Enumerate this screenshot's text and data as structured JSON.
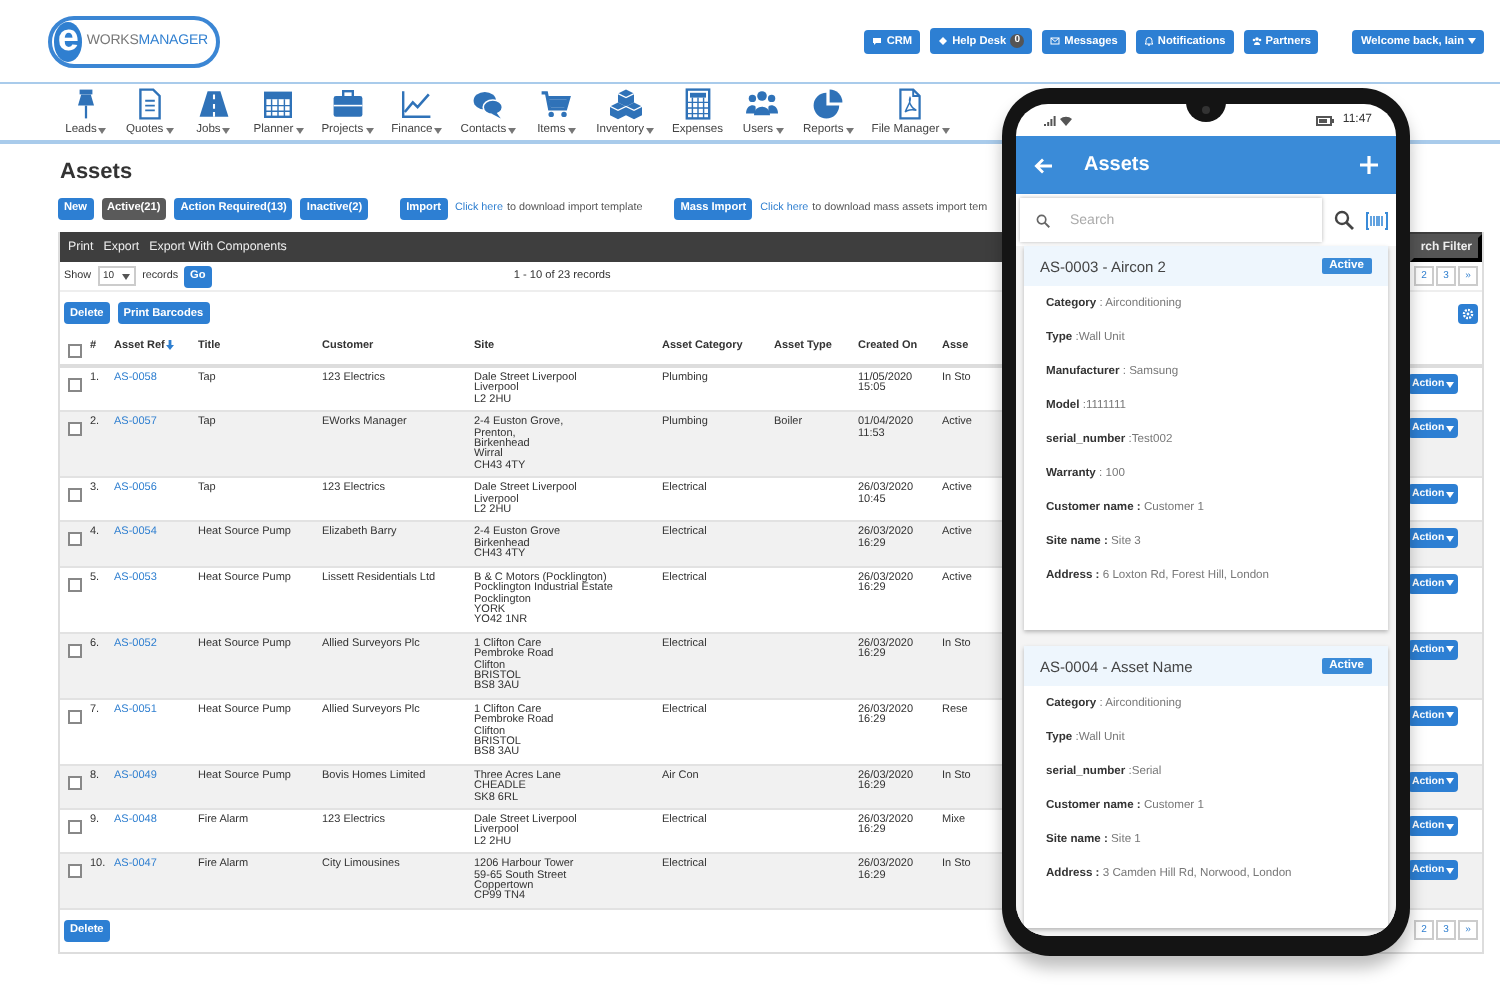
{
  "header": {
    "logo": {
      "mark": "e",
      "prefix": "WORKS",
      "name": "MANAGER"
    },
    "buttons": [
      {
        "label": "CRM"
      },
      {
        "label": "Help Desk",
        "badge": "0"
      },
      {
        "label": "Messages"
      },
      {
        "label": "Notifications"
      },
      {
        "label": "Partners"
      }
    ],
    "user_menu": "Welcome back, Iain"
  },
  "nav": [
    {
      "label": "Leads",
      "dropdown": true
    },
    {
      "label": "Quotes",
      "dropdown": true
    },
    {
      "label": "Jobs",
      "dropdown": true
    },
    {
      "label": "Planner",
      "dropdown": true
    },
    {
      "label": "Projects",
      "dropdown": true
    },
    {
      "label": "Finance",
      "dropdown": true
    },
    {
      "label": "Contacts",
      "dropdown": true
    },
    {
      "label": "Items",
      "dropdown": true
    },
    {
      "label": "Inventory",
      "dropdown": true
    },
    {
      "label": "Expenses",
      "dropdown": false
    },
    {
      "label": "Users",
      "dropdown": true
    },
    {
      "label": "Reports",
      "dropdown": true
    },
    {
      "label": "File Manager",
      "dropdown": true
    }
  ],
  "page": {
    "title": "Assets",
    "new_button": "New",
    "filters": [
      {
        "label": "Active(21)",
        "selected": true
      },
      {
        "label": "Action Required(13)",
        "selected": false
      },
      {
        "label": "Inactive(2)",
        "selected": false
      }
    ],
    "import_button": "Import",
    "import_link": "Click here",
    "import_text": "to download import template",
    "mass_import_button": "Mass Import",
    "mass_import_link": "Click here",
    "mass_import_text": "to download mass assets import tem",
    "export_menu": [
      "Print",
      "Export",
      "Export With Components"
    ],
    "filter_button": "rch Filter",
    "show_label": "Show",
    "page_size": "10",
    "records_label": "records",
    "go_button": "Go",
    "summary": "1 - 10 of 23 records",
    "pages": [
      "2",
      "3",
      "»"
    ],
    "bulk_buttons": [
      "Delete",
      "Print Barcodes"
    ],
    "select_all_checked": false,
    "columns": [
      "#",
      "Asset Ref",
      "Title",
      "Customer",
      "Site",
      "Asset Category",
      "Asset Type",
      "Created On",
      "Asse"
    ],
    "rows": [
      {
        "checked": false,
        "n": "1.",
        "ref": "AS-0058",
        "title": "Tap",
        "customer": "123 Electrics",
        "site": [
          "Dale Street Liverpool",
          "Liverpool",
          "L2 2HU"
        ],
        "category": "Plumbing",
        "type": "",
        "created": "11/05/2020 15:05",
        "status": "In Sto",
        "action": "Action"
      },
      {
        "checked": false,
        "n": "2.",
        "ref": "AS-0057",
        "title": "Tap",
        "customer": "EWorks Manager",
        "site": [
          "2-4 Euston Grove,",
          "Prenton,",
          "Birkenhead",
          "Wirral",
          "CH43 4TY"
        ],
        "category": "Plumbing",
        "type": "Boiler",
        "created": "01/04/2020 11:53",
        "status": "Active",
        "action": "Action"
      },
      {
        "checked": false,
        "n": "3.",
        "ref": "AS-0056",
        "title": "Tap",
        "customer": "123 Electrics",
        "site": [
          "Dale Street Liverpool",
          "Liverpool",
          "L2 2HU"
        ],
        "category": "Electrical",
        "type": "",
        "created": "26/03/2020 10:45",
        "status": "Active",
        "action": "Action"
      },
      {
        "checked": false,
        "n": "4.",
        "ref": "AS-0054",
        "title": "Heat Source Pump",
        "customer": "Elizabeth Barry",
        "site": [
          "2-4 Euston Grove",
          "Birkenhead",
          "CH43 4TY"
        ],
        "category": "Electrical",
        "type": "",
        "created": "26/03/2020 16:29",
        "status": "Active",
        "action": "Action"
      },
      {
        "checked": false,
        "n": "5.",
        "ref": "AS-0053",
        "title": "Heat Source Pump",
        "customer": "Lissett Residentials Ltd",
        "site": [
          "B & C Motors (Pocklington)",
          "Pocklington Industrial Estate",
          "Pocklington",
          "YORK",
          "YO42 1NR"
        ],
        "category": "Electrical",
        "type": "",
        "created": "26/03/2020 16:29",
        "status": "Active",
        "action": "Action"
      },
      {
        "checked": false,
        "n": "6.",
        "ref": "AS-0052",
        "title": "Heat Source Pump",
        "customer": "Allied Surveyors Plc",
        "site": [
          "1 Clifton Care",
          "Pembroke Road",
          "Clifton",
          "BRISTOL",
          "BS8 3AU"
        ],
        "category": "Electrical",
        "type": "",
        "created": "26/03/2020 16:29",
        "status": "In Sto",
        "action": "Action"
      },
      {
        "checked": false,
        "n": "7.",
        "ref": "AS-0051",
        "title": "Heat Source Pump",
        "customer": "Allied Surveyors Plc",
        "site": [
          "1 Clifton Care",
          "Pembroke Road",
          "Clifton",
          "BRISTOL",
          "BS8 3AU"
        ],
        "category": "Electrical",
        "type": "",
        "created": "26/03/2020 16:29",
        "status": "Rese",
        "action": "Action"
      },
      {
        "checked": false,
        "n": "8.",
        "ref": "AS-0049",
        "title": "Heat Source Pump",
        "customer": "Bovis Homes Limited",
        "site": [
          "Three Acres Lane",
          "CHEADLE",
          "SK8 6RL"
        ],
        "category": "Air Con",
        "type": "",
        "created": "26/03/2020 16:29",
        "status": "In Sto",
        "action": "Action"
      },
      {
        "checked": false,
        "n": "9.",
        "ref": "AS-0048",
        "title": "Fire Alarm",
        "customer": "123 Electrics",
        "site": [
          "Dale Street Liverpool",
          "Liverpool",
          "L2 2HU"
        ],
        "category": "Electrical",
        "type": "",
        "created": "26/03/2020 16:29",
        "status": "Mixe",
        "action": "Action"
      },
      {
        "checked": false,
        "n": "10.",
        "ref": "AS-0047",
        "title": "Fire Alarm",
        "customer": "City Limousines",
        "site": [
          "1206 Harbour Tower",
          "59-65 South Street",
          "Coppertown",
          "CP99 TN4"
        ],
        "category": "Electrical",
        "type": "",
        "created": "26/03/2020 16:29",
        "status": "In Sto",
        "action": "Action"
      }
    ],
    "bottom_button": "Delete",
    "bottom_pages": [
      "2",
      "3",
      "»"
    ]
  },
  "phone": {
    "time": "11:47",
    "title": "Assets",
    "search_placeholder": "Search",
    "cards": [
      {
        "title": "AS-0003 - Aircon 2",
        "status": "Active",
        "fields": [
          "**Category** : Airconditioning",
          "**Type** :Wall Unit",
          "**Manufacturer** : Samsung",
          "**Model** :1111111",
          "**serial_number** :Test002",
          "**Warranty** : 100",
          "**Customer name :** Customer 1",
          "**Site name :** Site 3",
          "**Address :** 6 Loxton Rd, Forest Hill, London"
        ]
      },
      {
        "title": "AS-0004 - Asset Name",
        "status": "Active",
        "fields": [
          "**Category** : Airconditioning",
          "**Type** :Wall Unit",
          "**serial_number** :Serial",
          "**Customer name :** Customer 1",
          "**Site name :** Site 1",
          "**Address :** 3 Camden Hill Rd, Norwood, London"
        ]
      }
    ]
  }
}
